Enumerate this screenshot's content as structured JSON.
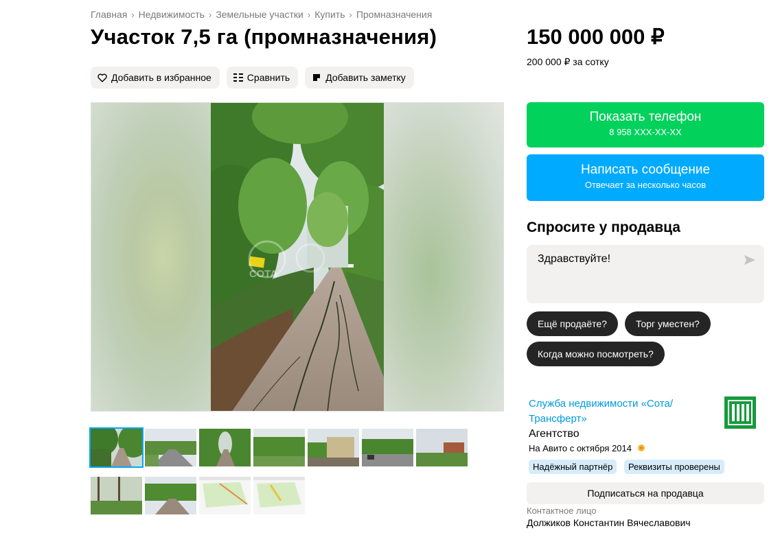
{
  "breadcrumb": [
    "Главная",
    "Недвижимость",
    "Земельные участки",
    "Купить",
    "Промназначения"
  ],
  "title": "Участок 7,5 га (промназначения)",
  "actions": {
    "favorite": "Добавить в избранное",
    "compare": "Сравнить",
    "note": "Добавить заметку"
  },
  "gallery": {
    "watermark": "СОТА",
    "thumb_count": 11,
    "active_thumb": 1
  },
  "price": {
    "value": "150 000 000 ₽",
    "per_unit": "200 000 ₽ за сотку"
  },
  "contact_buttons": {
    "phone_label": "Показать телефон",
    "phone_number": "8 958 XXX-XX-XX",
    "message_label": "Написать сообщение",
    "message_sub": "Отвечает за несколько часов"
  },
  "ask": {
    "title": "Спросите у продавца",
    "message": "Здравствуйте!",
    "chips": [
      "Ещё продаёте?",
      "Торг уместен?",
      "Когда можно посмотреть?"
    ]
  },
  "seller": {
    "name": "Служба недвижимости «Сота/ Трансферт»",
    "type": "Агентство",
    "since": "На Авито с октября 2014",
    "badges": [
      "Надёжный партнёр",
      "Реквизиты проверены"
    ],
    "subscribe": "Подписаться на продавца",
    "contact_label": "Контактное лицо",
    "contact_name": "Должиков Константин Вячеславович"
  },
  "colors": {
    "green": "#02d15c",
    "blue": "#00aaff",
    "link": "#0099dd",
    "chip": "#252525"
  }
}
